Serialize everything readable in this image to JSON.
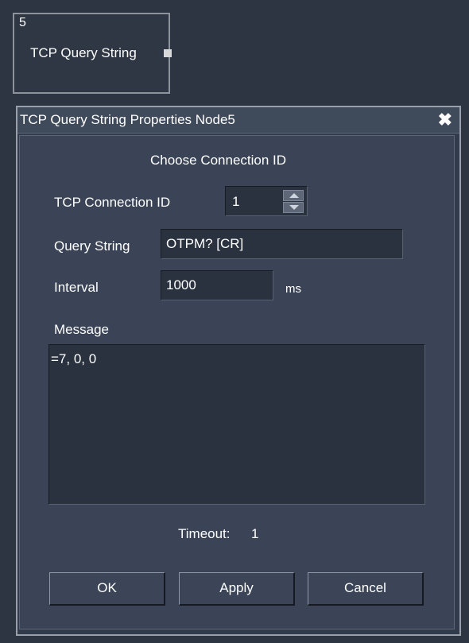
{
  "node": {
    "id": "5",
    "label": "TCP Query String"
  },
  "dialog": {
    "title": "TCP Query String Properties Node5",
    "close_glyph": "✖",
    "heading": "Choose Connection ID",
    "connection_id": {
      "label": "TCP Connection ID",
      "value": "1"
    },
    "query_string": {
      "label": "Query String",
      "value": "OTPM? [CR]"
    },
    "interval": {
      "label": "Interval",
      "value": "1000",
      "unit": "ms"
    },
    "message": {
      "label": "Message",
      "value": "=7, 0, 0"
    },
    "timeout": {
      "label": "Timeout:",
      "value": "1"
    },
    "buttons": {
      "ok": "OK",
      "apply": "Apply",
      "cancel": "Cancel"
    }
  },
  "colors": {
    "background": "#2d3542",
    "dialog_panel": "#3a4456",
    "field": "#2a3240",
    "text": "#ffffff"
  },
  "icons": [
    "close-icon",
    "spin-up-icon",
    "spin-down-icon",
    "output-port-icon"
  ]
}
